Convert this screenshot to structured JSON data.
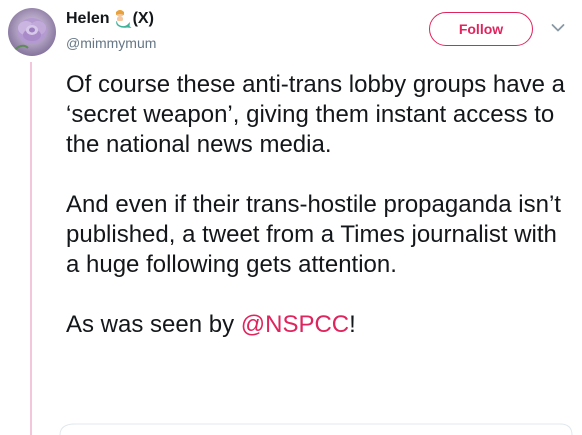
{
  "author": {
    "display_name": "Helen",
    "name_emoji": "mermaid-emoji",
    "name_suffix": "(X)",
    "handle": "@mimmymum",
    "avatar": "purple-rose-avatar"
  },
  "follow_button": {
    "label": "Follow"
  },
  "menu_icon": "chevron-down-icon",
  "tweet": {
    "paragraph_1": "Of course these anti-trans lobby groups have a ‘secret weapon’, giving them instant access to the national news media.",
    "paragraph_2": "And even if their trans-hostile propaganda isn’t published, a tweet from a Times journalist with a huge following gets attention.",
    "paragraph_3_prefix": "As was seen by ",
    "mention": "@NSPCC",
    "paragraph_3_suffix": "!"
  },
  "colors": {
    "accent": "#e0245e",
    "handle": "#657786",
    "text": "#14171a",
    "thread_line": "#f3c7d9"
  }
}
